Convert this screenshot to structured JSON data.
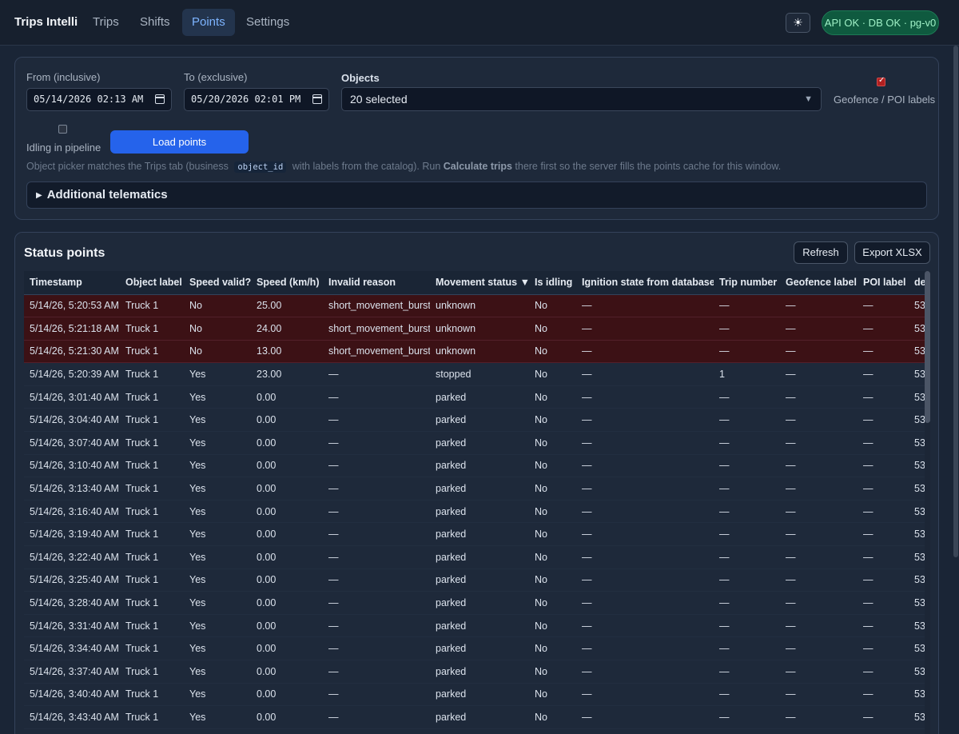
{
  "app": {
    "brand": "Trips Intelli",
    "nav": [
      "Trips",
      "Shifts",
      "Points",
      "Settings"
    ],
    "active_nav": "Points",
    "theme_icon": "sun-icon",
    "theme_glyph": "☀",
    "status": "API OK · DB OK · pg-v0"
  },
  "filters": {
    "from_label": "From (inclusive)",
    "from_value": "05/14/2026 02:13 AM",
    "to_label": "To (exclusive)",
    "to_value": "05/20/2026 02:01 PM",
    "objects_label": "Objects",
    "objects_value": "20 selected",
    "geofence_label": "Geofence / POI labels",
    "geofence_checked": true,
    "idling_label": "Idling in pipeline",
    "idling_checked": false,
    "load_button": "Load points",
    "hint_part1": "Object picker matches the Trips tab (business",
    "hint_code": "object_id",
    "hint_part2": "with labels from the catalog). Run",
    "hint_bold": "Calculate trips",
    "hint_part3": "there first so the server fills the points cache for this window.",
    "additional_label": "Additional telematics"
  },
  "points": {
    "title": "Status points",
    "refresh_button": "Refresh",
    "export_button": "Export XLSX",
    "columns": [
      "Timestamp",
      "Object label",
      "Speed valid?",
      "Speed (km/h)",
      "Invalid reason",
      "Movement status ▼",
      "Is idling",
      "Ignition state from database",
      "Trip number",
      "Geofence label",
      "POI label",
      "de"
    ],
    "rows": [
      {
        "invalid": true,
        "cells": [
          "5/14/26, 5:20:53 AM",
          "Truck 1",
          "No",
          "25.00",
          "short_movement_burst",
          "unknown",
          "No",
          "—",
          "—",
          "—",
          "—",
          "53"
        ]
      },
      {
        "invalid": true,
        "cells": [
          "5/14/26, 5:21:18 AM",
          "Truck 1",
          "No",
          "24.00",
          "short_movement_burst",
          "unknown",
          "No",
          "—",
          "—",
          "—",
          "—",
          "53"
        ]
      },
      {
        "invalid": true,
        "cells": [
          "5/14/26, 5:21:30 AM",
          "Truck 1",
          "No",
          "13.00",
          "short_movement_burst",
          "unknown",
          "No",
          "—",
          "—",
          "—",
          "—",
          "53"
        ]
      },
      {
        "invalid": false,
        "cells": [
          "5/14/26, 5:20:39 AM",
          "Truck 1",
          "Yes",
          "23.00",
          "—",
          "stopped",
          "No",
          "—",
          "1",
          "—",
          "—",
          "53"
        ]
      },
      {
        "invalid": false,
        "cells": [
          "5/14/26, 3:01:40 AM",
          "Truck 1",
          "Yes",
          "0.00",
          "—",
          "parked",
          "No",
          "—",
          "—",
          "—",
          "—",
          "53"
        ]
      },
      {
        "invalid": false,
        "cells": [
          "5/14/26, 3:04:40 AM",
          "Truck 1",
          "Yes",
          "0.00",
          "—",
          "parked",
          "No",
          "—",
          "—",
          "—",
          "—",
          "53"
        ]
      },
      {
        "invalid": false,
        "cells": [
          "5/14/26, 3:07:40 AM",
          "Truck 1",
          "Yes",
          "0.00",
          "—",
          "parked",
          "No",
          "—",
          "—",
          "—",
          "—",
          "53"
        ]
      },
      {
        "invalid": false,
        "cells": [
          "5/14/26, 3:10:40 AM",
          "Truck 1",
          "Yes",
          "0.00",
          "—",
          "parked",
          "No",
          "—",
          "—",
          "—",
          "—",
          "53"
        ]
      },
      {
        "invalid": false,
        "cells": [
          "5/14/26, 3:13:40 AM",
          "Truck 1",
          "Yes",
          "0.00",
          "—",
          "parked",
          "No",
          "—",
          "—",
          "—",
          "—",
          "53"
        ]
      },
      {
        "invalid": false,
        "cells": [
          "5/14/26, 3:16:40 AM",
          "Truck 1",
          "Yes",
          "0.00",
          "—",
          "parked",
          "No",
          "—",
          "—",
          "—",
          "—",
          "53"
        ]
      },
      {
        "invalid": false,
        "cells": [
          "5/14/26, 3:19:40 AM",
          "Truck 1",
          "Yes",
          "0.00",
          "—",
          "parked",
          "No",
          "—",
          "—",
          "—",
          "—",
          "53"
        ]
      },
      {
        "invalid": false,
        "cells": [
          "5/14/26, 3:22:40 AM",
          "Truck 1",
          "Yes",
          "0.00",
          "—",
          "parked",
          "No",
          "—",
          "—",
          "—",
          "—",
          "53"
        ]
      },
      {
        "invalid": false,
        "cells": [
          "5/14/26, 3:25:40 AM",
          "Truck 1",
          "Yes",
          "0.00",
          "—",
          "parked",
          "No",
          "—",
          "—",
          "—",
          "—",
          "53"
        ]
      },
      {
        "invalid": false,
        "cells": [
          "5/14/26, 3:28:40 AM",
          "Truck 1",
          "Yes",
          "0.00",
          "—",
          "parked",
          "No",
          "—",
          "—",
          "—",
          "—",
          "53"
        ]
      },
      {
        "invalid": false,
        "cells": [
          "5/14/26, 3:31:40 AM",
          "Truck 1",
          "Yes",
          "0.00",
          "—",
          "parked",
          "No",
          "—",
          "—",
          "—",
          "—",
          "53"
        ]
      },
      {
        "invalid": false,
        "cells": [
          "5/14/26, 3:34:40 AM",
          "Truck 1",
          "Yes",
          "0.00",
          "—",
          "parked",
          "No",
          "—",
          "—",
          "—",
          "—",
          "53"
        ]
      },
      {
        "invalid": false,
        "cells": [
          "5/14/26, 3:37:40 AM",
          "Truck 1",
          "Yes",
          "0.00",
          "—",
          "parked",
          "No",
          "—",
          "—",
          "—",
          "—",
          "53"
        ]
      },
      {
        "invalid": false,
        "cells": [
          "5/14/26, 3:40:40 AM",
          "Truck 1",
          "Yes",
          "0.00",
          "—",
          "parked",
          "No",
          "—",
          "—",
          "—",
          "—",
          "53"
        ]
      },
      {
        "invalid": false,
        "cells": [
          "5/14/26, 3:43:40 AM",
          "Truck 1",
          "Yes",
          "0.00",
          "—",
          "parked",
          "No",
          "—",
          "—",
          "—",
          "—",
          "53"
        ]
      }
    ]
  },
  "colors": {
    "background": "#1a2536",
    "accent": "#2563eb",
    "active_tab_text": "#7db4ff",
    "invalid_row": "#3c1115",
    "status_ok": "#0f5a3f"
  }
}
